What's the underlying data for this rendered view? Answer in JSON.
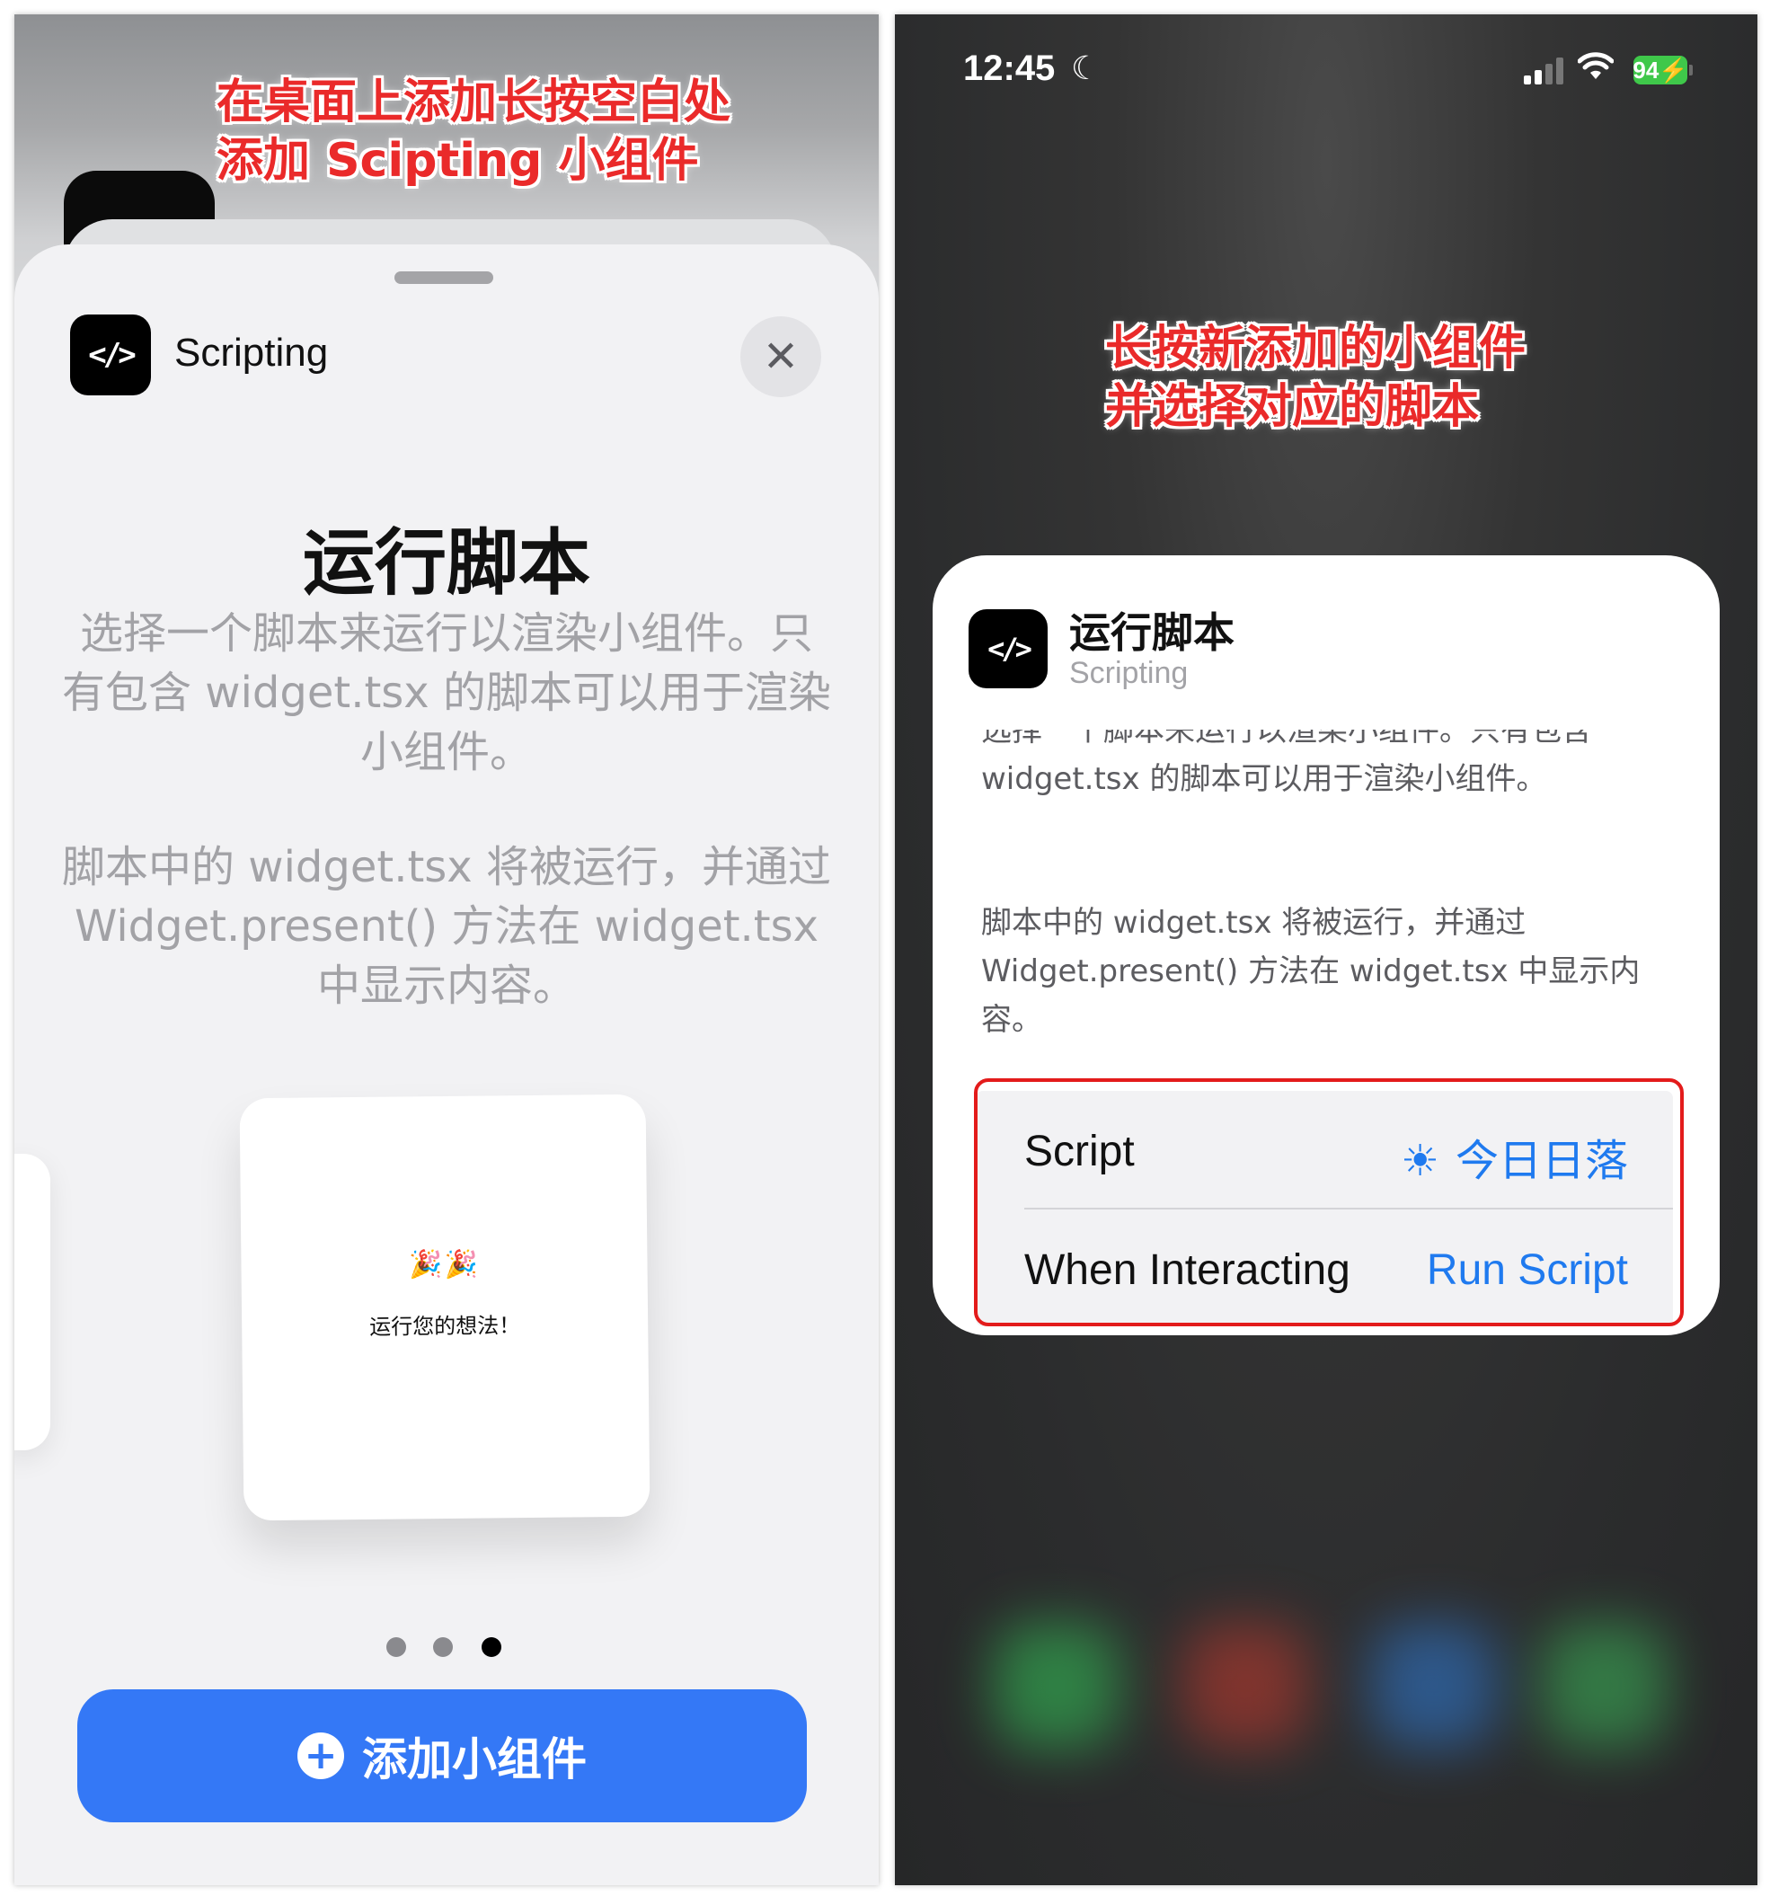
{
  "left": {
    "annotation_line1": "在桌面上添加长按空白处",
    "annotation_line2": "添加 Scipting 小组件",
    "app_icon": "</>",
    "app_name": "Scripting",
    "close_icon": "✕",
    "title": "运行脚本",
    "description_1": "选择一个脚本来运行以渲染小组件。只有包含 widget.tsx 的脚本可以用于渲染小组件。",
    "description_2": "脚本中的 widget.tsx 将被运行，并通过 Widget.present() 方法在 widget.tsx 中显示内容。",
    "preview_emoji": "🎉🎉",
    "preview_text": "运行您的想法！",
    "page_count": 3,
    "current_page": 3,
    "add_button_icon": "+",
    "add_button_label": "添加小组件"
  },
  "right": {
    "status": {
      "time": "12:45",
      "moon_icon": "☾",
      "wifi_icon": "wifi-icon",
      "battery": "94"
    },
    "annotation_line1": "长按新添加的小组件",
    "annotation_line2": "并选择对应的脚本",
    "card": {
      "app_icon": "</>",
      "title": "运行脚本",
      "subtitle": "Scripting",
      "description_1": "选择一个脚本来运行以渲染小组件。只有包含 widget.tsx 的脚本可以用于渲染小组件。",
      "description_2": "脚本中的 widget.tsx 将被运行，并通过 Widget.present() 方法在 widget.tsx 中显示内容。",
      "options": {
        "script_label": "Script",
        "script_icon": "☀",
        "script_value": "今日日落",
        "interaction_label": "When Interacting",
        "interaction_value": "Run Script"
      }
    }
  },
  "colors": {
    "annotation": "#ea2a2a",
    "accent_blue": "#3478f6",
    "link_blue": "#1f7aef",
    "highlight_box": "#e31b1b",
    "battery_green": "#3fc84a"
  }
}
